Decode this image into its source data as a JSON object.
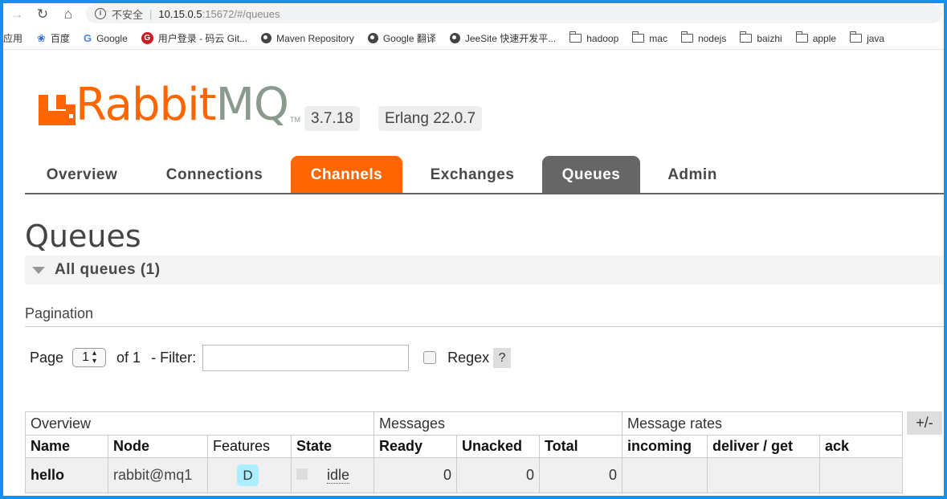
{
  "browser": {
    "address": {
      "security_label": "不安全",
      "host": "10.15.0.5",
      "rest": ":15672/#/queues"
    },
    "bookmarks": [
      {
        "label": "应用",
        "icon": "apps-icon"
      },
      {
        "label": "百度",
        "icon": "baidu-icon"
      },
      {
        "label": "Google",
        "icon": "google-icon"
      },
      {
        "label": "用户登录 - 码云 Git...",
        "icon": "gitee-icon"
      },
      {
        "label": "Maven Repository",
        "icon": "globe-icon"
      },
      {
        "label": "Google 翻译",
        "icon": "globe-icon"
      },
      {
        "label": "JeeSite 快速开发平...",
        "icon": "globe-icon"
      },
      {
        "label": "hadoop",
        "icon": "folder-icon"
      },
      {
        "label": "mac",
        "icon": "folder-icon"
      },
      {
        "label": "nodejs",
        "icon": "folder-icon"
      },
      {
        "label": "baizhi",
        "icon": "folder-icon"
      },
      {
        "label": "apple",
        "icon": "folder-icon"
      },
      {
        "label": "java",
        "icon": "folder-icon"
      }
    ]
  },
  "header": {
    "logo_rabbit": "Rabbit",
    "logo_mq": "MQ",
    "logo_tm": "TM",
    "version": "3.7.18",
    "erlang": "Erlang 22.0.7"
  },
  "tabs": [
    {
      "label": "Overview"
    },
    {
      "label": "Connections"
    },
    {
      "label": "Channels"
    },
    {
      "label": "Exchanges"
    },
    {
      "label": "Queues"
    },
    {
      "label": "Admin"
    }
  ],
  "page": {
    "title": "Queues",
    "section_title": "All queues (1)",
    "pagination_label": "Pagination",
    "page_label": "Page",
    "page_value": "1",
    "of_label": "of 1",
    "filter_label": "- Filter:",
    "filter_value": "",
    "regex_label": "Regex",
    "help_label": "?"
  },
  "table": {
    "groups": [
      "Overview",
      "Messages",
      "Message rates"
    ],
    "columns": [
      "Name",
      "Node",
      "Features",
      "State",
      "Ready",
      "Unacked",
      "Total",
      "incoming",
      "deliver / get",
      "ack"
    ],
    "toggle_label": "+/-",
    "rows": [
      {
        "name": "hello",
        "node": "rabbit@mq1",
        "feature": "D",
        "state": "idle",
        "ready": "0",
        "unacked": "0",
        "total": "0",
        "incoming": "",
        "deliver_get": "",
        "ack": ""
      }
    ]
  },
  "colors": {
    "accent_orange": "#ff6600",
    "active_grey": "#666666",
    "durable_badge": "#aaeeff",
    "frame_blue": "#1a8fe8"
  }
}
